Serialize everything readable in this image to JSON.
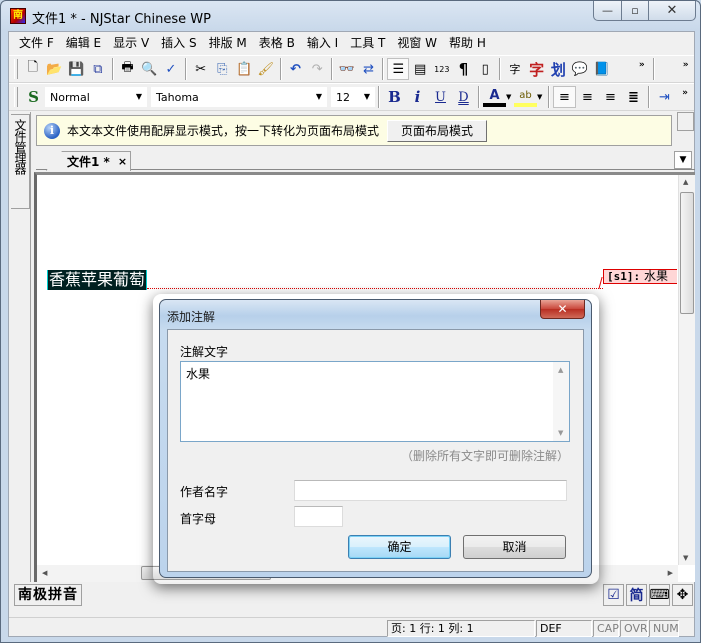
{
  "window": {
    "title": "文件1 * - NJStar Chinese WP",
    "app_icon_glyph": "南",
    "controls": {
      "minimize": "—",
      "maximize": "▫",
      "close": "✕"
    }
  },
  "menu": [
    {
      "label": "文件 F"
    },
    {
      "label": "编辑 E"
    },
    {
      "label": "显示 V"
    },
    {
      "label": "插入 S"
    },
    {
      "label": "排版 M"
    },
    {
      "label": "表格 B"
    },
    {
      "label": "输入 I"
    },
    {
      "label": "工具 T"
    },
    {
      "label": "视窗 W"
    },
    {
      "label": "帮助 H"
    }
  ],
  "toolbar1": {
    "icons": {
      "new": "🗋",
      "open": "📂",
      "save": "💾",
      "save_all": "⧉",
      "print": "🖶",
      "print_preview": "🔍",
      "spell_check": "✓",
      "cut": "✂",
      "copy": "⎘",
      "paste": "📋",
      "format_painter": "🖌",
      "undo": "↶",
      "redo": "↷",
      "find": "👓",
      "replace": "⇄",
      "view_page": "☰",
      "view_normal": "▤",
      "ruler": "123",
      "paragraph_marks": "¶",
      "frame": "▯",
      "dictionary": "字",
      "char": "字",
      "stroke": "划",
      "comment": "💬",
      "book": "📘",
      "more": "»"
    }
  },
  "toolbar2": {
    "style_icon": "S",
    "style_value": "Normal",
    "font_value": "Tahoma",
    "size_value": "12",
    "bold": "B",
    "italic": "i",
    "underline": "U",
    "double_underline": "D",
    "font_color": "A",
    "highlight": "ab",
    "more": "»"
  },
  "side_panel": {
    "tab_label": "文件管理器"
  },
  "infobar": {
    "icon": "i",
    "message": "本文本文件使用配屏显示模式，按一下转化为页面布局模式",
    "button_label": "页面布局模式"
  },
  "doc_tab": {
    "label": "文件1 *",
    "close": "×",
    "dropdown": "▼"
  },
  "editor": {
    "selected_text": "香蕉苹果葡萄",
    "comment_tag": "[s1]:",
    "comment_text": "水果"
  },
  "bottom": {
    "ime_label": "南极拼音",
    "ime_icons": {
      "check": "☑",
      "simplified": "简",
      "keyboard": "⌨",
      "move": "✥"
    }
  },
  "status": {
    "position": "页: 1   行: 1    列: 1",
    "mode": "DEF",
    "cap": "CAP",
    "ovr": "OVR",
    "num": "NUM"
  },
  "dialog": {
    "title": "添加注解",
    "close": "✕",
    "comment_label": "注解文字",
    "comment_value": "水果",
    "hint": "（删除所有文字即可删除注解）",
    "author_label": "作者名字",
    "author_value": "",
    "initials_label": "首字母",
    "initials_value": "",
    "ok_label": "确定",
    "cancel_label": "取消"
  }
}
